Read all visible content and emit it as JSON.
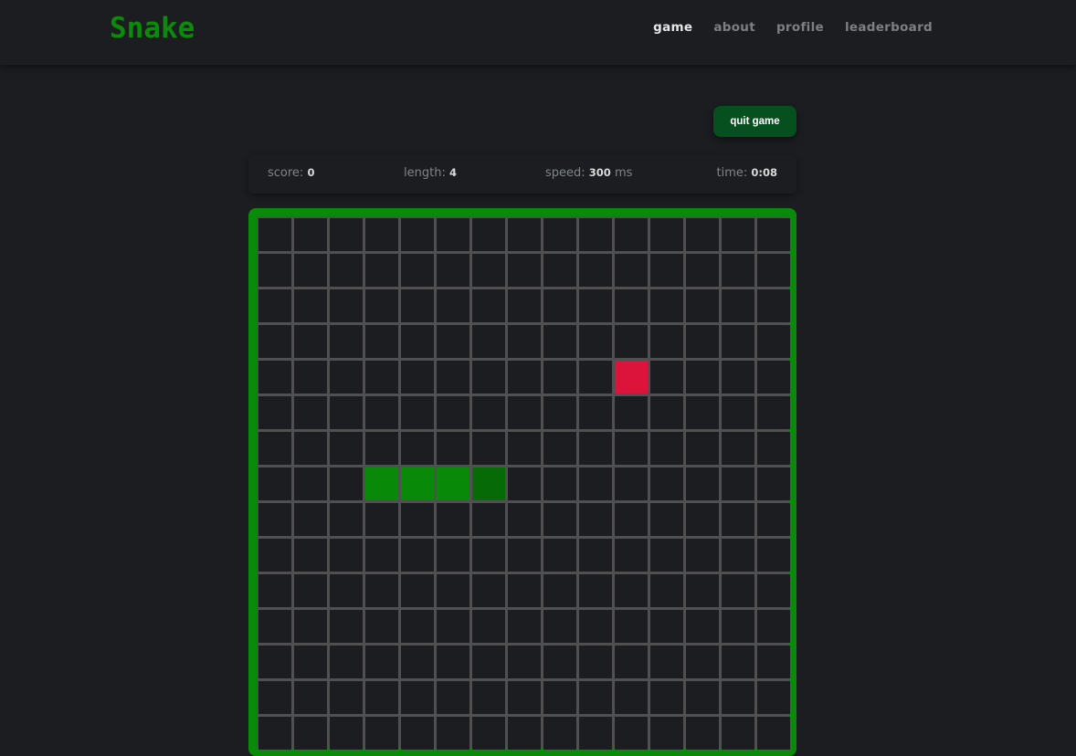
{
  "header": {
    "logo": "Snake",
    "nav": [
      {
        "label": "game",
        "active": true
      },
      {
        "label": "about",
        "active": false
      },
      {
        "label": "profile",
        "active": false
      },
      {
        "label": "leaderboard",
        "active": false
      }
    ]
  },
  "controls": {
    "quit_label": "quit game"
  },
  "stats": {
    "score_label": "score:",
    "score_value": "0",
    "length_label": "length:",
    "length_value": "4",
    "speed_label": "speed:",
    "speed_value": "300",
    "speed_unit": "ms",
    "time_label": "time:",
    "time_value": "0:08"
  },
  "board": {
    "cols": 15,
    "rows": 15,
    "snake": [
      [
        3,
        7
      ],
      [
        4,
        7
      ],
      [
        5,
        7
      ],
      [
        6,
        7
      ]
    ],
    "head": [
      6,
      7
    ],
    "food": [
      10,
      4
    ],
    "colors": {
      "frame": "#0a8a0a",
      "grid_line": "#505052",
      "empty": "#1b1d21",
      "snake_body": "#088a08",
      "snake_head": "#066b06",
      "food": "#dc143c"
    }
  }
}
